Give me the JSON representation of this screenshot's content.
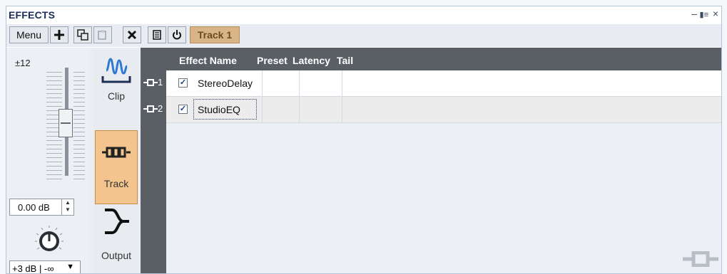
{
  "panel": {
    "title": "EFFECTS"
  },
  "window_controls": {
    "minimize": "‒",
    "layout": "▮≡",
    "close": "×"
  },
  "toolbar": {
    "menu_label": "Menu",
    "add_icon": "plus-icon",
    "duplicate_icon": "duplicate-icon",
    "paste_icon": "paste-icon",
    "remove_icon": "remove-icon",
    "list_icon": "list-icon",
    "power_icon": "power-icon",
    "target_label": "Track 1"
  },
  "left": {
    "range_label": "±12",
    "volume_value": "0.00 dB",
    "pan_law": "+3 dB | -∞",
    "modes": [
      {
        "label": "Clip",
        "icon": "clip-wave-icon",
        "active": false
      },
      {
        "label": "Track",
        "icon": "track-chain-icon",
        "active": true
      },
      {
        "label": "Output",
        "icon": "output-route-icon",
        "active": false
      }
    ]
  },
  "grid": {
    "columns": [
      "Effect Name",
      "Preset",
      "Latency",
      "Tail"
    ],
    "rows": [
      {
        "index": "1",
        "enabled": true,
        "name": "StereoDelay",
        "preset": "",
        "latency": "",
        "tail": ""
      },
      {
        "index": "2",
        "enabled": true,
        "name": "StudioEQ",
        "preset": "",
        "latency": "",
        "tail": ""
      }
    ]
  },
  "colors": {
    "accent": "#f3c48d",
    "track_chip": "#d9b487",
    "header": "#5a5f66",
    "title": "#1b2e55"
  }
}
